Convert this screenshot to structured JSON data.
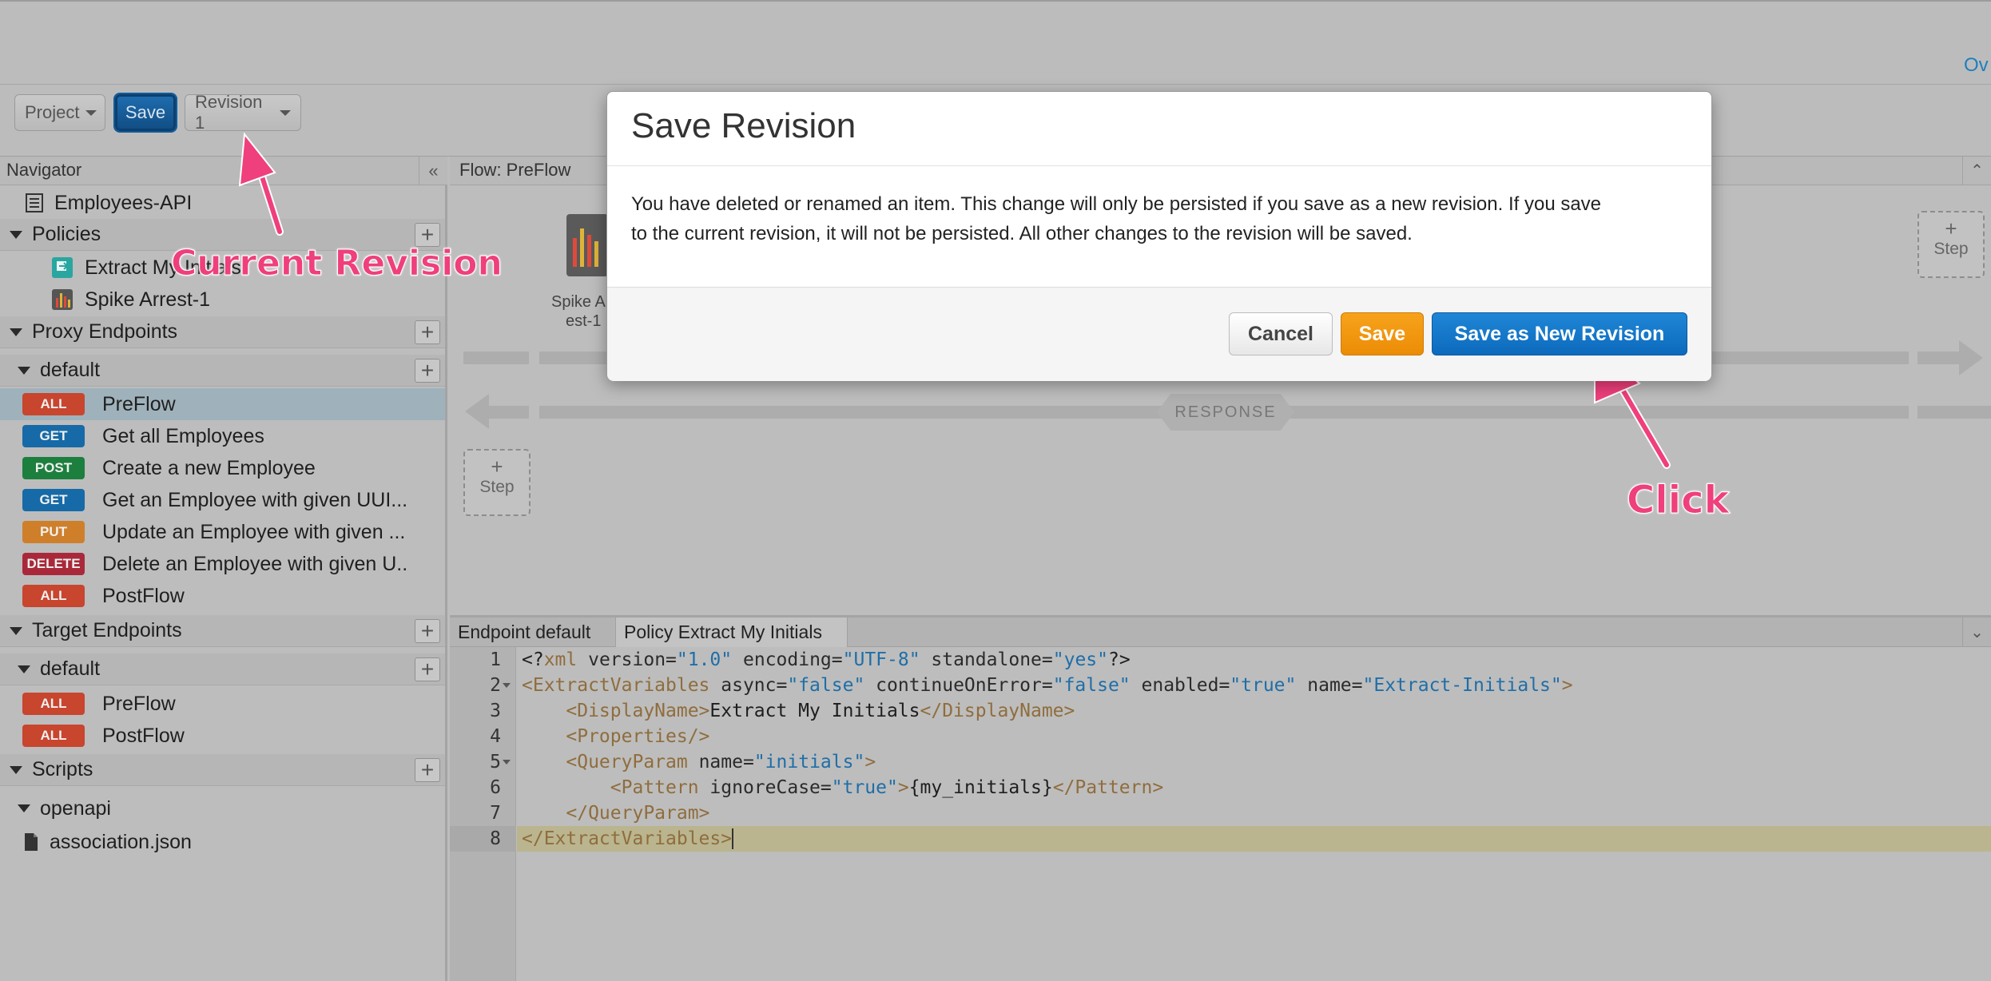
{
  "topbar": {
    "overflow_link": "Ov"
  },
  "toolbar": {
    "project_label": "Project",
    "save_label": "Save",
    "revision_label": "Revision 1"
  },
  "navigator": {
    "title": "Navigator",
    "collapse_glyph": "«",
    "api_name": "Employees-API",
    "policies": {
      "label": "Policies",
      "items": [
        {
          "label": "Extract My Initials"
        },
        {
          "label": "Spike Arrest-1"
        }
      ]
    },
    "proxy_endpoints": {
      "label": "Proxy Endpoints",
      "default_label": "default",
      "flows": [
        {
          "method": "ALL",
          "label": "PreFlow"
        },
        {
          "method": "GET",
          "label": "Get all Employees"
        },
        {
          "method": "POST",
          "label": "Create a new Employee"
        },
        {
          "method": "GET",
          "label": "Get an Employee with given UUI..."
        },
        {
          "method": "PUT",
          "label": "Update an Employee with given ..."
        },
        {
          "method": "DELETE",
          "label": "Delete an Employee with given U.."
        },
        {
          "method": "ALL",
          "label": "PostFlow"
        }
      ]
    },
    "target_endpoints": {
      "label": "Target Endpoints",
      "default_label": "default",
      "flows": [
        {
          "method": "ALL",
          "label": "PreFlow"
        },
        {
          "method": "ALL",
          "label": "PostFlow"
        }
      ]
    },
    "scripts": {
      "label": "Scripts",
      "folder": "openapi",
      "file": "association.json"
    }
  },
  "flow": {
    "title": "Flow: PreFlow",
    "step_plus": "+",
    "step_label": "Step",
    "policy_caption_1": "Spike A",
    "policy_caption_2": "est-1",
    "response_label": "RESPONSE"
  },
  "editor": {
    "tabs": [
      "Endpoint default",
      "Policy Extract My Initials"
    ],
    "line_numbers": [
      "1",
      "2",
      "3",
      "4",
      "5",
      "6",
      "7",
      "8"
    ]
  },
  "annotations": {
    "current_revision": "Current Revision",
    "click": "Click"
  },
  "modal": {
    "title": "Save Revision",
    "body_line1": "You have deleted or renamed an item. This change will only be persisted if you save as a new revision. If you save",
    "body_line2": "to the current revision, it will not be persisted. All other changes to the revision will be saved.",
    "cancel_label": "Cancel",
    "save_label": "Save",
    "save_new_label": "Save as New Revision"
  },
  "colors": {
    "save_blue": "#1f86d6",
    "save_orange": "#f7a21b",
    "annotation_pink": "#ef3f7c",
    "method_all": "#c8452e",
    "method_get": "#166aa7",
    "method_post": "#1c7f3e",
    "method_put": "#cf7f2a",
    "method_delete": "#a9293a"
  }
}
